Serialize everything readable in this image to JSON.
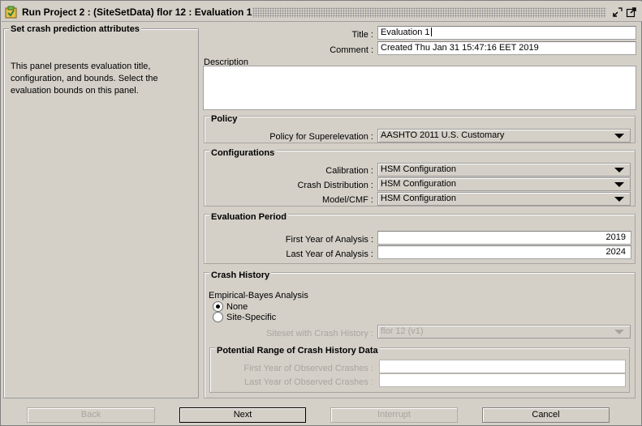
{
  "window": {
    "title": "Run Project 2 : (SiteSetData) flor 12 : Evaluation 1"
  },
  "left_panel": {
    "title": "Set crash prediction attributes",
    "description": "This panel presents evaluation title, configuration, and bounds. Select the evaluation bounds on this panel."
  },
  "form": {
    "title_label": "Title :",
    "title_value": "Evaluation 1",
    "comment_label": "Comment :",
    "comment_value": "Created Thu Jan 31 15:47:16 EET 2019",
    "description_label": "Description"
  },
  "policy": {
    "group_title": "Policy",
    "superelevation_label": "Policy for Superelevation :",
    "superelevation_value": "AASHTO 2011 U.S. Customary"
  },
  "configurations": {
    "group_title": "Configurations",
    "calibration_label": "Calibration :",
    "calibration_value": "HSM Configuration",
    "crash_distribution_label": "Crash Distribution :",
    "crash_distribution_value": "HSM Configuration",
    "model_cmf_label": "Model/CMF :",
    "model_cmf_value": "HSM Configuration"
  },
  "evaluation_period": {
    "group_title": "Evaluation Period",
    "first_year_label": "First Year of Analysis :",
    "first_year_value": "2019",
    "last_year_label": "Last Year of Analysis :",
    "last_year_value": "2024"
  },
  "crash_history": {
    "group_title": "Crash History",
    "eb_label": "Empirical-Bayes Analysis",
    "option_none": "None",
    "option_site_specific": "Site-Specific",
    "selected_option": "None",
    "siteset_label": "Siteset with Crash History :",
    "siteset_value": "flor 12 (v1)",
    "range_group_title": "Potential Range of Crash History Data",
    "first_observed_label": "First Year of Observed Crashes :",
    "first_observed_value": "",
    "last_observed_label": "Last Year of Observed Crashes :",
    "last_observed_value": ""
  },
  "buttons": {
    "back": "Back",
    "next": "Next",
    "interrupt": "Interrupt",
    "cancel": "Cancel"
  }
}
